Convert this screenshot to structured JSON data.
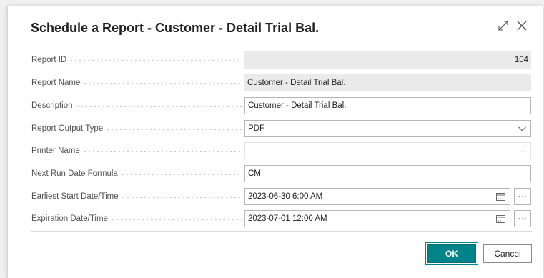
{
  "dialog": {
    "title": "Schedule a Report - Customer - Detail Trial Bal.",
    "icons": {
      "expand": "expand-diagonal-icon",
      "close": "close-x-icon"
    }
  },
  "fields": {
    "report_id": {
      "label": "Report ID",
      "value": "104"
    },
    "report_name": {
      "label": "Report Name",
      "value": "Customer - Detail Trial Bal."
    },
    "description": {
      "label": "Description",
      "value": "Customer - Detail Trial Bal."
    },
    "report_output_type": {
      "label": "Report Output Type",
      "value": "PDF"
    },
    "printer_name": {
      "label": "Printer Name",
      "value": ""
    },
    "next_run_date_formula": {
      "label": "Next Run Date Formula",
      "value": "CM"
    },
    "earliest_start": {
      "label": "Earliest Start Date/Time",
      "value": "2023-06-30 6:00 AM"
    },
    "expiration": {
      "label": "Expiration Date/Time",
      "value": "2023-07-01 12:00 AM"
    }
  },
  "buttons": {
    "ok": "OK",
    "cancel": "Cancel",
    "more": "···"
  },
  "colors": {
    "accent": "#008489",
    "readonly_bg": "#eaeaea",
    "border": "#b6b6b6"
  }
}
